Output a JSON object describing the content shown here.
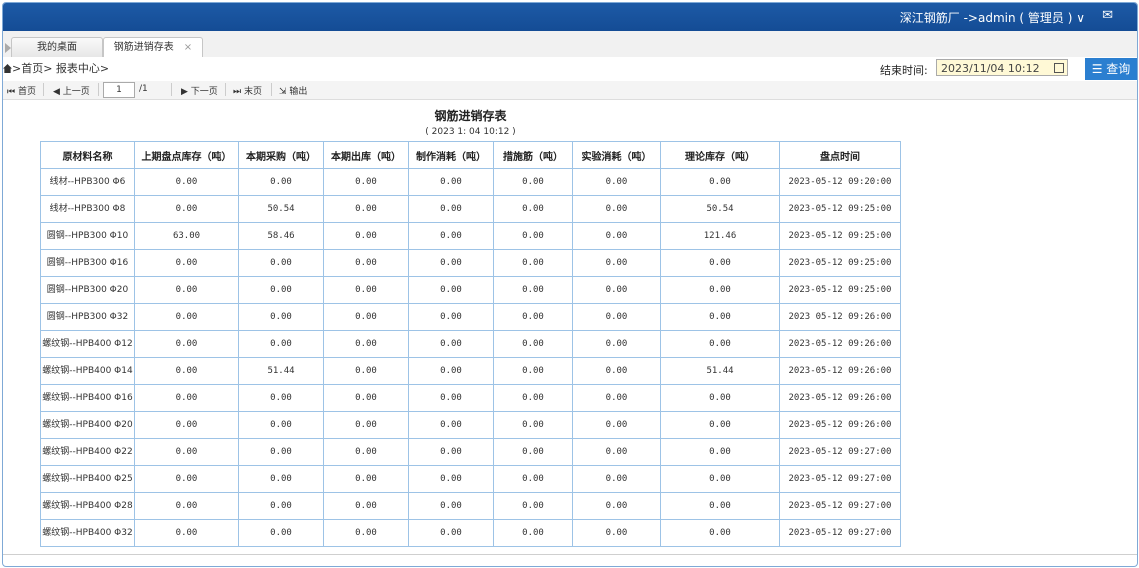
{
  "header": {
    "user_label": "深江钢筋厂  ->admin ( 管理员 ) ∨",
    "mail_icon": "mail-icon"
  },
  "tabs": [
    {
      "label": "我的桌面"
    },
    {
      "label": "钢筋进销存表",
      "close": "×"
    }
  ],
  "breadcrumb": ">首页> 报表中心>",
  "filter": {
    "end_time_label": "结束时间:",
    "end_time_value": "2023/11/04 10:12",
    "query_label": "查询"
  },
  "pager": {
    "first": "首页",
    "prev": "上一页",
    "page": "1",
    "total": "/1",
    "next": "下一页",
    "last": "末页",
    "export": "输出"
  },
  "report": {
    "title": "钢筋进销存表",
    "subtitle": "( 2023 1: 04 10:12 )",
    "columns": [
      "原材料名称",
      "上期盘点库存（吨）",
      "本期采购（吨）",
      "本期出库（吨）",
      "制作消耗（吨）",
      "措施筋（吨）",
      "实验消耗（吨）",
      "理论库存（吨）",
      "盘点时间"
    ],
    "rows": [
      {
        "name": "线材--HPB300  Φ6",
        "c1": "0.00",
        "c2": "0.00",
        "c3": "0.00",
        "c4": "0.00",
        "c5": "0.00",
        "c6": "0.00",
        "c7": "0.00",
        "time": "2023-05-12 09:20:00"
      },
      {
        "name": "线材--HPB300  Φ8",
        "c1": "0.00",
        "c2": "50.54",
        "c3": "0.00",
        "c4": "0.00",
        "c5": "0.00",
        "c6": "0.00",
        "c7": "50.54",
        "time": "2023-05-12 09:25:00"
      },
      {
        "name": "圆钢--HPB300 Φ10",
        "c1": "63.00",
        "c2": "58.46",
        "c3": "0.00",
        "c4": "0.00",
        "c5": "0.00",
        "c6": "0.00",
        "c7": "121.46",
        "time": "2023-05-12 09:25:00"
      },
      {
        "name": "圆钢--HPB300 Φ16",
        "c1": "0.00",
        "c2": "0.00",
        "c3": "0.00",
        "c4": "0.00",
        "c5": "0.00",
        "c6": "0.00",
        "c7": "0.00",
        "time": "2023-05-12 09:25:00"
      },
      {
        "name": "圆钢--HPB300 Φ20",
        "c1": "0.00",
        "c2": "0.00",
        "c3": "0.00",
        "c4": "0.00",
        "c5": "0.00",
        "c6": "0.00",
        "c7": "0.00",
        "time": "2023-05-12 09:25:00"
      },
      {
        "name": "圆钢--HPB300 Φ32",
        "c1": "0.00",
        "c2": "0.00",
        "c3": "0.00",
        "c4": "0.00",
        "c5": "0.00",
        "c6": "0.00",
        "c7": "0.00",
        "time": "2023 05-12 09:26:00"
      },
      {
        "name": "螺纹钢--HPB400 Φ12",
        "c1": "0.00",
        "c2": "0.00",
        "c3": "0.00",
        "c4": "0.00",
        "c5": "0.00",
        "c6": "0.00",
        "c7": "0.00",
        "time": "2023-05-12 09:26:00"
      },
      {
        "name": "螺纹钢--HPB400 Φ14",
        "c1": "0.00",
        "c2": "51.44",
        "c3": "0.00",
        "c4": "0.00",
        "c5": "0.00",
        "c6": "0.00",
        "c7": "51.44",
        "time": "2023-05-12 09:26:00"
      },
      {
        "name": "螺纹钢--HPB400 Φ16",
        "c1": "0.00",
        "c2": "0.00",
        "c3": "0.00",
        "c4": "0.00",
        "c5": "0.00",
        "c6": "0.00",
        "c7": "0.00",
        "time": "2023-05-12 09:26:00"
      },
      {
        "name": "螺纹钢--HPB400 Φ20",
        "c1": "0.00",
        "c2": "0.00",
        "c3": "0.00",
        "c4": "0.00",
        "c5": "0.00",
        "c6": "0.00",
        "c7": "0.00",
        "time": "2023-05-12 09:26:00"
      },
      {
        "name": "螺纹钢--HPB400 Φ22",
        "c1": "0.00",
        "c2": "0.00",
        "c3": "0.00",
        "c4": "0.00",
        "c5": "0.00",
        "c6": "0.00",
        "c7": "0.00",
        "time": "2023-05-12 09:27:00"
      },
      {
        "name": "螺纹钢--HPB400 Φ25",
        "c1": "0.00",
        "c2": "0.00",
        "c3": "0.00",
        "c4": "0.00",
        "c5": "0.00",
        "c6": "0.00",
        "c7": "0.00",
        "time": "2023-05-12 09:27:00"
      },
      {
        "name": "螺纹钢--HPB400 Φ28",
        "c1": "0.00",
        "c2": "0.00",
        "c3": "0.00",
        "c4": "0.00",
        "c5": "0.00",
        "c6": "0.00",
        "c7": "0.00",
        "time": "2023-05-12 09:27:00"
      },
      {
        "name": "螺纹钢--HPB400 Φ32",
        "c1": "0.00",
        "c2": "0.00",
        "c3": "0.00",
        "c4": "0.00",
        "c5": "0.00",
        "c6": "0.00",
        "c7": "0.00",
        "time": "2023-05-12 09:27:00"
      }
    ]
  }
}
